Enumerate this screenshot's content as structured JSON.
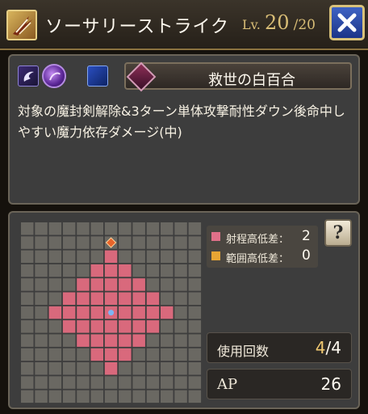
{
  "header": {
    "skill_icon": "slash-claw-icon",
    "title": "ソーサリーストライク",
    "level_label": "Lv.",
    "level_current": "20",
    "level_max": "/20",
    "close_icon": "close-x-icon"
  },
  "info": {
    "attribute_icons": [
      "dark-spirit-icon",
      "dark-orb-icon",
      "crescent-moon-icon"
    ],
    "ability_icon": "lily-crest-icon",
    "ability_name": "救世の白百合",
    "description": "対象の魔封剣解除&3ターン単体攻撃耐性ダウン後命中しやすい魔力依存ダメージ(中)"
  },
  "range": {
    "grid_cols": 13,
    "grid_rows": 13,
    "range_cells": [
      [
        6,
        2
      ],
      [
        5,
        3
      ],
      [
        6,
        3
      ],
      [
        7,
        3
      ],
      [
        4,
        4
      ],
      [
        5,
        4
      ],
      [
        6,
        4
      ],
      [
        7,
        4
      ],
      [
        8,
        4
      ],
      [
        3,
        5
      ],
      [
        4,
        5
      ],
      [
        5,
        5
      ],
      [
        6,
        5
      ],
      [
        7,
        5
      ],
      [
        8,
        5
      ],
      [
        9,
        5
      ],
      [
        2,
        6
      ],
      [
        3,
        6
      ],
      [
        4,
        6
      ],
      [
        5,
        6
      ],
      [
        6,
        6
      ],
      [
        7,
        6
      ],
      [
        8,
        6
      ],
      [
        9,
        6
      ],
      [
        10,
        6
      ],
      [
        3,
        7
      ],
      [
        4,
        7
      ],
      [
        5,
        7
      ],
      [
        6,
        7
      ],
      [
        7,
        7
      ],
      [
        8,
        7
      ],
      [
        9,
        7
      ],
      [
        4,
        8
      ],
      [
        5,
        8
      ],
      [
        6,
        8
      ],
      [
        7,
        8
      ],
      [
        8,
        8
      ],
      [
        5,
        9
      ],
      [
        6,
        9
      ],
      [
        7,
        9
      ],
      [
        6,
        10
      ]
    ],
    "center_cell": [
      6,
      6
    ],
    "marker_cell": [
      6,
      1
    ],
    "colors": {
      "grid_cell": "#6a6862",
      "range_cell": "#d9697c",
      "center_marker": "#7db6f5",
      "top_marker": "#e8642a"
    },
    "legend": [
      {
        "label": "射程高低差：",
        "value": "2",
        "color": "#e07089"
      },
      {
        "label": "範囲高低差：",
        "value": "0",
        "color": "#e8a534"
      }
    ],
    "help_icon": "help-book-icon",
    "help_glyph": "?"
  },
  "stats": {
    "uses_label": "使用回数",
    "uses_current": "4",
    "uses_max": "/4",
    "ap_label": "AP",
    "ap_value": "26"
  }
}
